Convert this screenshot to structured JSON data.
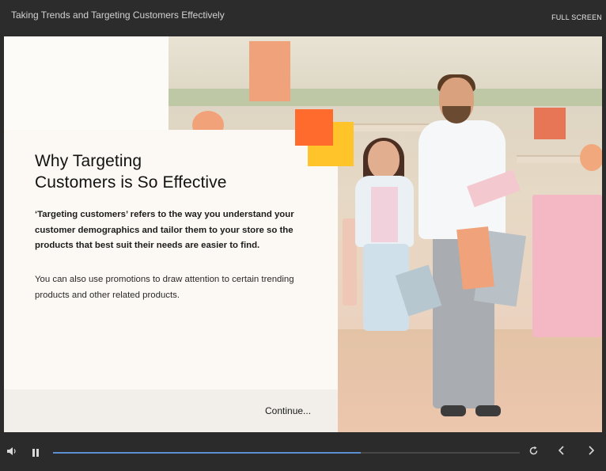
{
  "window": {
    "title": "Taking Trends and Targeting Customers Effectively",
    "fullscreen_label": "FULL SCREEN"
  },
  "slide": {
    "heading_line1": "Why Targeting",
    "heading_line2": "Customers is So Effective",
    "paragraph1": "‘Targeting customers’ refers to the way you understand your customer demographics and tailor them to your store so the products that best suit their needs are easier to find.",
    "paragraph2": "You can also use promotions to draw attention to certain trending products and other related products.",
    "continue_label": "Continue...",
    "accent_colors": {
      "orange": "#ff6b2c",
      "yellow": "#ffc42a"
    }
  },
  "player": {
    "progress_fraction": 0.66,
    "icons": [
      "volume-icon",
      "pause-icon",
      "replay-icon",
      "chevron-left-icon",
      "chevron-right-icon"
    ],
    "progress_color": "#5b8fd1"
  }
}
